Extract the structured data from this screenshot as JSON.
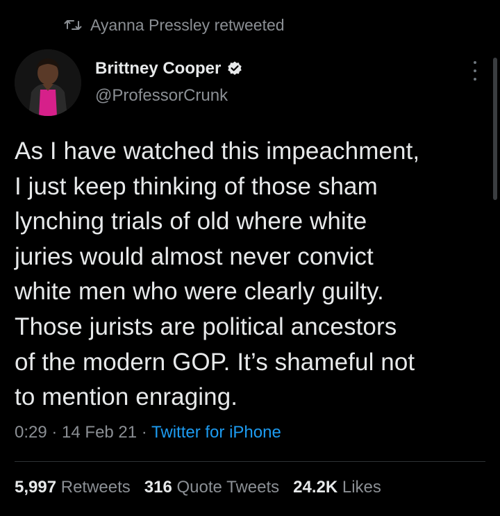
{
  "retweet_context": {
    "icon": "retweet-icon",
    "text": "Ayanna Pressley retweeted"
  },
  "author": {
    "display_name": "Brittney Cooper",
    "verified_icon": "verified-badge-icon",
    "handle": "@ProfessorCrunk"
  },
  "tweet": {
    "lines": [
      "As I have watched this impeachment,",
      "I just keep thinking of those sham",
      "lynching trials of old where white",
      "juries would almost never convict",
      "white men who were clearly guilty.",
      "Those jurists are political ancestors",
      "of the modern GOP. It’s shameful not",
      "to mention enraging."
    ]
  },
  "meta": {
    "time": "0:29",
    "separator": " · ",
    "date": "14 Feb 21",
    "source": "Twitter for iPhone"
  },
  "stats": {
    "retweets_count": "5,997",
    "retweets_label": "Retweets",
    "quotes_count": "316",
    "quotes_label": "Quote Tweets",
    "likes_count": "24.2K",
    "likes_label": "Likes"
  },
  "colors": {
    "background": "#000000",
    "text_primary": "#e7e9ea",
    "text_secondary": "#8b8f94",
    "link": "#1d9bf0",
    "verified": "#e7e9ea"
  }
}
